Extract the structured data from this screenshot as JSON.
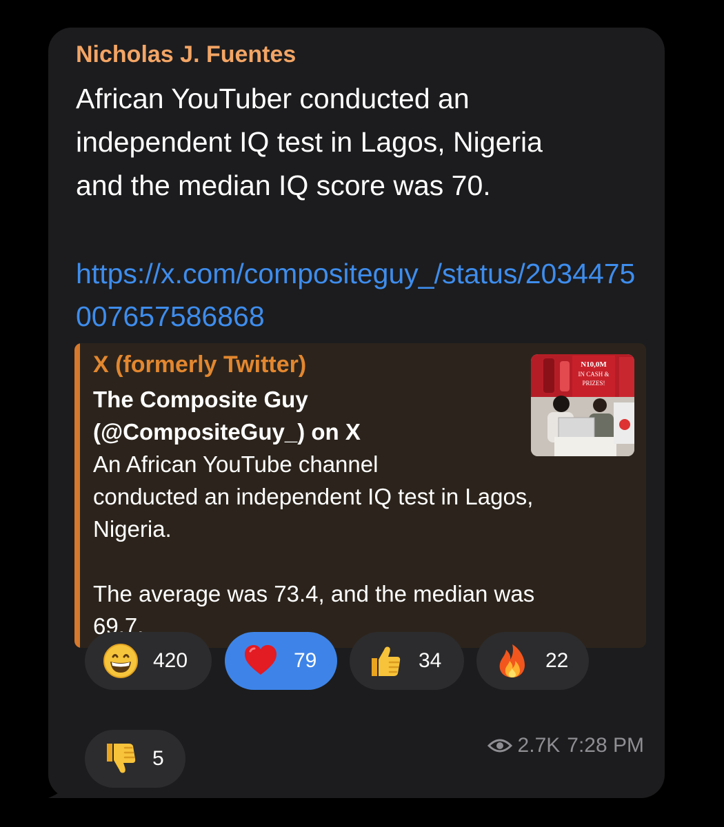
{
  "message": {
    "sender": "Nicholas J. Fuentes",
    "text": "African YouTuber conducted an\nindependent IQ test in Lagos, Nigeria\nand the median IQ score was 70.",
    "link": "https://x.com/compositeguy_/status/2034475007657586868"
  },
  "preview": {
    "site": "X (formerly Twitter)",
    "title": "The Composite Guy (@CompositeGuy_) on X",
    "description": "An African YouTube channel\nconducted an independent IQ test in Lagos,\nNigeria.\n\nThe average was 73.4, and the median was\n69.7.",
    "thumbnail_text": [
      "N10,0M",
      "IN CASH &",
      "PRIZES!"
    ]
  },
  "reactions": [
    {
      "emoji": "grinning-face-icon",
      "count": "420",
      "active": false
    },
    {
      "emoji": "red-heart-icon",
      "count": "79",
      "active": true
    },
    {
      "emoji": "thumbs-up-icon",
      "count": "34",
      "active": false
    },
    {
      "emoji": "fire-icon",
      "count": "22",
      "active": false
    },
    {
      "emoji": "thumbs-down-icon",
      "count": "5",
      "active": false
    }
  ],
  "meta": {
    "views": "2.7K",
    "time": "7:28 PM"
  },
  "colors": {
    "background": "#000000",
    "bubble": "#1c1c1e",
    "sender": "#f3a565",
    "link": "#3e8ded",
    "preview_accent": "#d6782d",
    "active_reaction": "#3e84e8"
  }
}
